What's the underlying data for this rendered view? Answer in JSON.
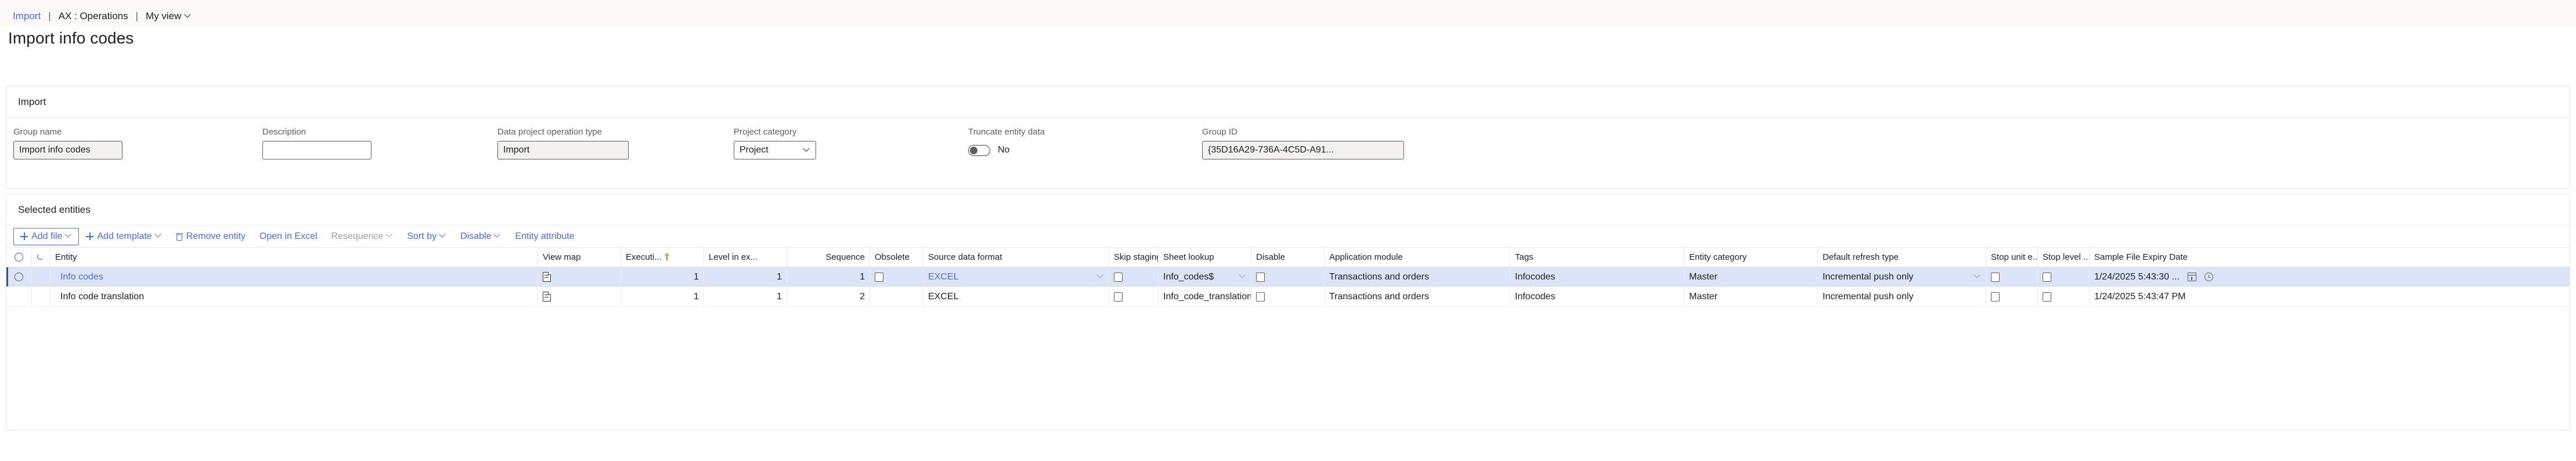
{
  "breadcrumb": {
    "link": "Import",
    "sep": "|",
    "module": "AX : Operations",
    "view": "My view"
  },
  "page_title": "Import info codes",
  "import_card": {
    "header": "Import",
    "fields": {
      "group_name": {
        "label": "Group name",
        "value": "Import info codes"
      },
      "description": {
        "label": "Description",
        "value": ""
      },
      "operation_type": {
        "label": "Data project operation type",
        "value": "Import"
      },
      "project_category": {
        "label": "Project category",
        "value": "Project"
      },
      "truncate": {
        "label": "Truncate entity data",
        "value": "No"
      },
      "group_id": {
        "label": "Group ID",
        "value": "{35D16A29-736A-4C5D-A91..."
      }
    }
  },
  "entities_card": {
    "header": "Selected entities",
    "toolbar": {
      "add_file": "Add file",
      "add_template": "Add template",
      "remove_entity": "Remove entity",
      "open_in_excel": "Open in Excel",
      "resequence": "Resequence",
      "sort_by": "Sort by",
      "disable": "Disable",
      "entity_attribute": "Entity attribute"
    },
    "columns": [
      "Entity",
      "View map",
      "Executi...",
      "Level in ex...",
      "Sequence",
      "Obsolete",
      "Source data format",
      "Skip staging",
      "Sheet lookup",
      "Disable",
      "Application module",
      "Tags",
      "Entity category",
      "Default refresh type",
      "Stop unit e...",
      "Stop level ...",
      "Sample File Expiry Date"
    ],
    "rows": [
      {
        "selected": true,
        "entity": "Info codes",
        "execution_unit": "1",
        "level_in_execution": "1",
        "sequence": "1",
        "obsolete": false,
        "source_data_format": "EXCEL",
        "skip_staging": false,
        "sheet_lookup": "Info_codes$",
        "disable": false,
        "application_module": "Transactions and orders",
        "tags": "Infocodes",
        "entity_category": "Master",
        "default_refresh_type": "Incremental push only",
        "stop_unit_e": false,
        "stop_level": false,
        "sample_file_expiry_date": "1/24/2025 5:43:30 ..."
      },
      {
        "selected": false,
        "entity": "Info code translation",
        "execution_unit": "1",
        "level_in_execution": "1",
        "sequence": "2",
        "obsolete": null,
        "source_data_format": "EXCEL",
        "skip_staging": false,
        "sheet_lookup": "Info_code_translation$",
        "disable": false,
        "application_module": "Transactions and orders",
        "tags": "Infocodes",
        "entity_category": "Master",
        "default_refresh_type": "Incremental push only",
        "stop_unit_e": false,
        "stop_level": false,
        "sample_file_expiry_date": "1/24/2025 5:43:47 PM"
      }
    ]
  },
  "colors": {
    "accent": "#4f6bed",
    "selected_row": "#dce4f7",
    "selection_bar": "#2b579a",
    "sort_arrow": "#c17a20"
  }
}
